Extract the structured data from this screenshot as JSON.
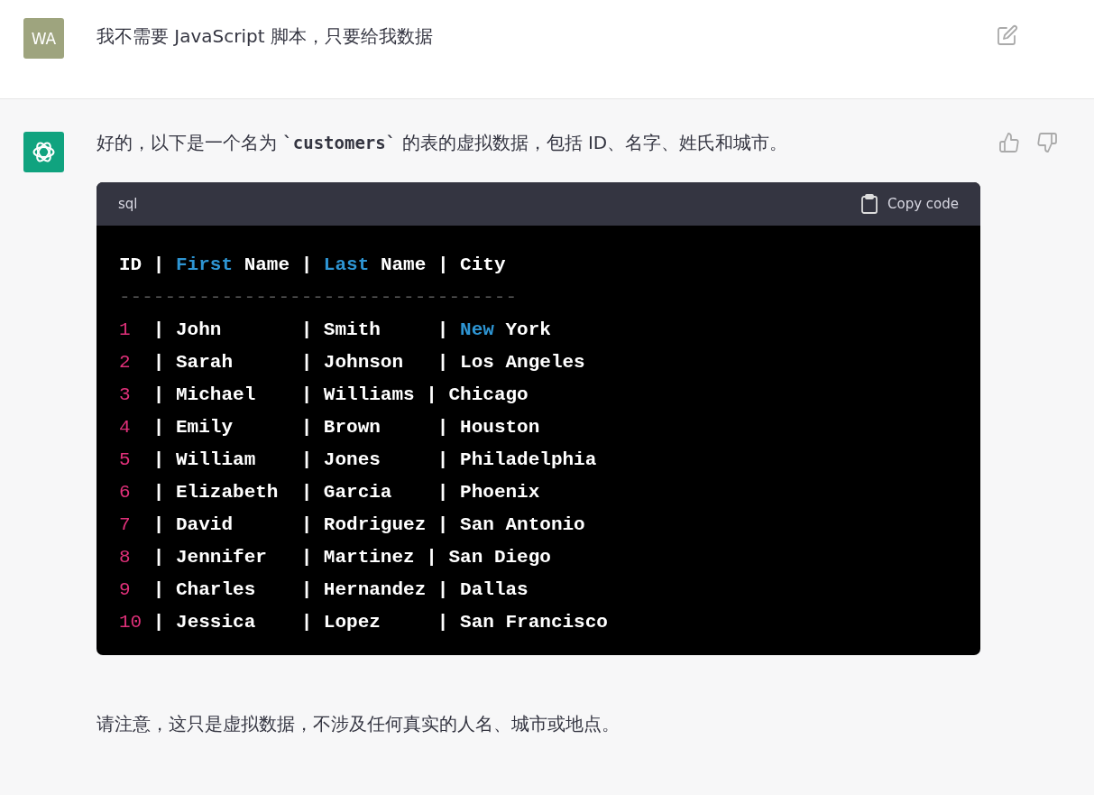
{
  "user_message": {
    "avatar": "WA",
    "text": "我不需要 JavaScript 脚本，只要给我数据"
  },
  "assistant_message": {
    "intro": "好的，以下是一个名为 **`customers`** 的表的虚拟数据，包括 ID、名字、姓氏和城市。",
    "code_block": {
      "language": "sql",
      "copy_label": "Copy code",
      "lines": [
        [
          {
            "text": "ID | ",
            "kind": "plain"
          },
          {
            "text": "First",
            "kind": "keyword"
          },
          {
            "text": " Name | ",
            "kind": "plain"
          },
          {
            "text": "Last",
            "kind": "keyword"
          },
          {
            "text": " Name | City",
            "kind": "plain"
          }
        ],
        [
          {
            "text": "-----------------------------------",
            "kind": "comment"
          }
        ],
        [
          {
            "text": "1",
            "kind": "number"
          },
          {
            "text": "  | John       | Smith     | ",
            "kind": "plain"
          },
          {
            "text": "New",
            "kind": "keyword"
          },
          {
            "text": " York",
            "kind": "plain"
          }
        ],
        [
          {
            "text": "2",
            "kind": "number"
          },
          {
            "text": "  | Sarah      | Johnson   | Los Angeles",
            "kind": "plain"
          }
        ],
        [
          {
            "text": "3",
            "kind": "number"
          },
          {
            "text": "  | Michael    | Williams | Chicago",
            "kind": "plain"
          }
        ],
        [
          {
            "text": "4",
            "kind": "number"
          },
          {
            "text": "  | Emily      | Brown     | Houston",
            "kind": "plain"
          }
        ],
        [
          {
            "text": "5",
            "kind": "number"
          },
          {
            "text": "  | William    | Jones     | Philadelphia",
            "kind": "plain"
          }
        ],
        [
          {
            "text": "6",
            "kind": "number"
          },
          {
            "text": "  | Elizabeth  | Garcia    | Phoenix",
            "kind": "plain"
          }
        ],
        [
          {
            "text": "7",
            "kind": "number"
          },
          {
            "text": "  | David      | Rodriguez | San Antonio",
            "kind": "plain"
          }
        ],
        [
          {
            "text": "8",
            "kind": "number"
          },
          {
            "text": "  | Jennifer   | Martinez | San Diego",
            "kind": "plain"
          }
        ],
        [
          {
            "text": "9",
            "kind": "number"
          },
          {
            "text": "  | Charles    | Hernandez | Dallas",
            "kind": "plain"
          }
        ],
        [
          {
            "text": "10",
            "kind": "number"
          },
          {
            "text": " | Jessica    | Lopez     | San Francisco",
            "kind": "plain"
          }
        ]
      ]
    },
    "note": "请注意，这只是虚拟数据，不涉及任何真实的人名、城市或地点。"
  }
}
